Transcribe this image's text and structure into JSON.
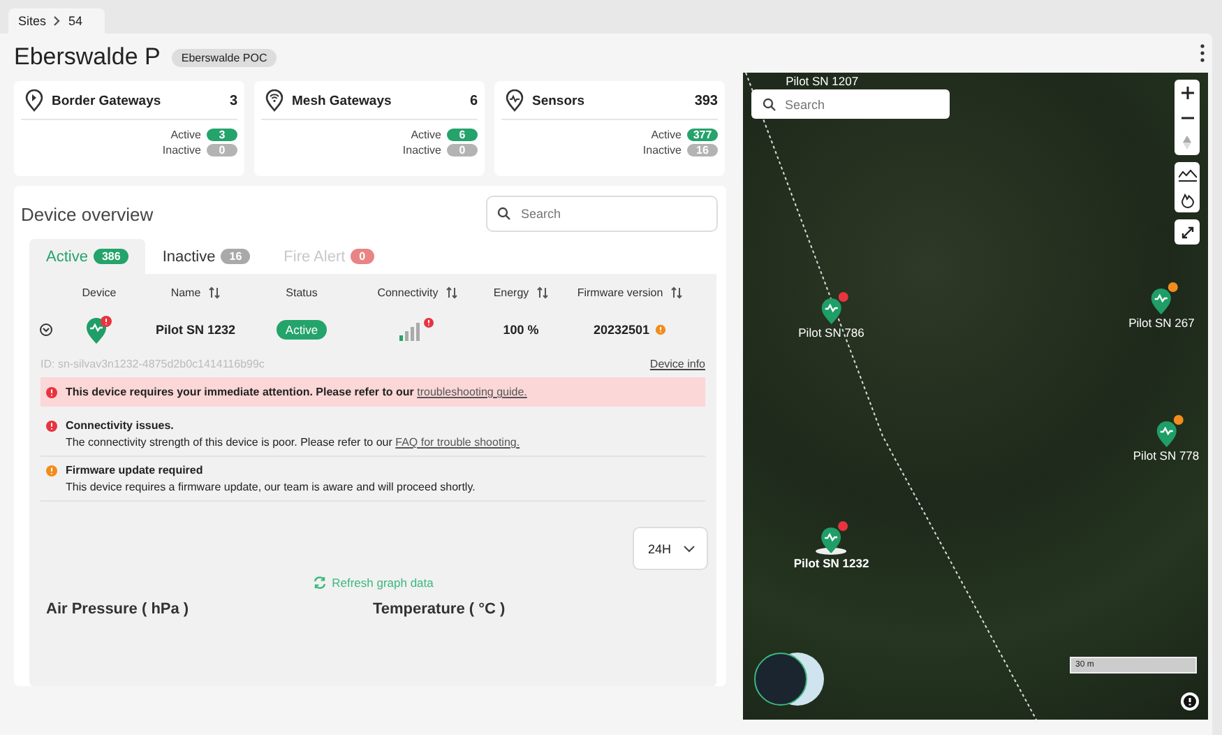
{
  "breadcrumb": [
    "Sites",
    "54"
  ],
  "title": "Eberswalde P",
  "tag": "Eberswalde POC",
  "stat_cards": [
    {
      "kind": "border",
      "title": "Border Gateways",
      "total": "3",
      "active_label": "Active",
      "active": "3",
      "inactive_label": "Inactive",
      "inactive": "0"
    },
    {
      "kind": "mesh",
      "title": "Mesh Gateways",
      "total": "6",
      "active_label": "Active",
      "active": "6",
      "inactive_label": "Inactive",
      "inactive": "0"
    },
    {
      "kind": "sensor",
      "title": "Sensors",
      "total": "393",
      "active_label": "Active",
      "active": "377",
      "inactive_label": "Inactive",
      "inactive": "16"
    }
  ],
  "device_overview": {
    "title": "Device overview",
    "search": {
      "placeholder": "Search"
    },
    "tabs": [
      {
        "label": "Active",
        "count": "386",
        "selected": true,
        "disabled": false,
        "color": "#24a36b"
      },
      {
        "label": "Inactive",
        "count": "16",
        "selected": false,
        "disabled": false,
        "color": "#a9a9a9"
      },
      {
        "label": "Fire Alert",
        "count": "0",
        "selected": false,
        "disabled": true,
        "color": "#e98484"
      }
    ],
    "columns": [
      {
        "label": "Device",
        "sortable": false
      },
      {
        "label": "Name",
        "sortable": true
      },
      {
        "label": "Status",
        "sortable": false
      },
      {
        "label": "Connectivity",
        "sortable": true
      },
      {
        "label": "Energy",
        "sortable": true
      },
      {
        "label": "Firmware version",
        "sortable": true
      }
    ],
    "row": {
      "expanded": true,
      "device_alert": true,
      "name": "Pilot SN 1232",
      "status": "Active",
      "connectivity_alert": true,
      "energy": "100 %",
      "firmware": "20232501",
      "firmware_warning": true
    },
    "device_id": "ID: sn-silvav3n1232-4875d2b0c1414116b99c",
    "device_info_link": "Device info",
    "alerts": [
      {
        "kind": "banner",
        "color": "#e8343f",
        "text": "This device requires your immediate attention. Please refer to our ",
        "link": "troubleshooting guide."
      },
      {
        "kind": "item",
        "color": "#e8343f",
        "title": "Connectivity issues.",
        "text": "The connectivity strength of this device is poor. Please refer to our ",
        "link": "FAQ for trouble shooting."
      },
      {
        "kind": "item",
        "color": "#f28c1c",
        "title": "Firmware update required",
        "text": "This device requires a firmware update, our team is aware and will proceed shortly."
      }
    ],
    "range": "24H",
    "refresh": "Refresh graph data",
    "chart_titles": [
      "Air Pressure (  hPa )",
      "Temperature ( °C )"
    ]
  },
  "map": {
    "search": {
      "placeholder": "Search"
    },
    "scale": "30 m",
    "markers": [
      {
        "label": "Pilot SN 1207",
        "selected": false
      },
      {
        "label": "Pilot SN 267",
        "selected": false,
        "color": "#f28c1c"
      },
      {
        "label": "Pilot SN 786",
        "selected": false,
        "color": "#e8343f"
      },
      {
        "label": "Pilot SN 778",
        "selected": false,
        "color": "#f28c1c"
      },
      {
        "label": "Pilot SN 1232",
        "selected": true,
        "color": "#e8343f"
      }
    ]
  }
}
